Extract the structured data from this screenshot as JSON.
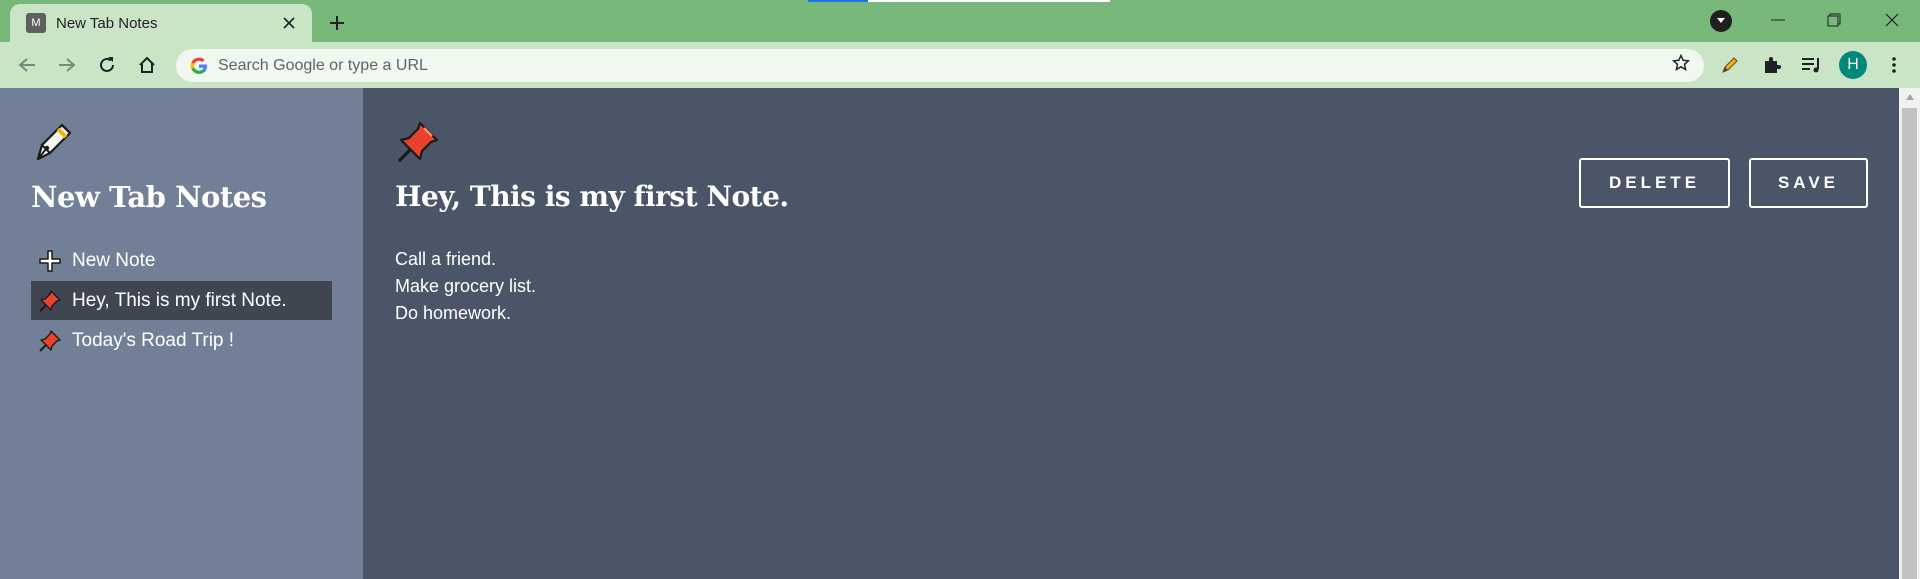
{
  "browser": {
    "tab": {
      "favicon_letter": "M",
      "title": "New Tab Notes"
    },
    "omnibox": {
      "placeholder": "Search Google or type a URL"
    },
    "profile_initial": "H",
    "icons": [
      "back-icon",
      "forward-icon",
      "reload-icon",
      "home-icon",
      "bookmark-star-icon",
      "pencil-extension-icon",
      "extensions-puzzle-icon",
      "reading-list-icon",
      "menu-kebab-icon",
      "tab-search-icon",
      "minimize-icon",
      "restore-icon",
      "close-icon"
    ]
  },
  "sidebar": {
    "title": "New Tab Notes",
    "items": [
      {
        "label": "New Note",
        "icon": "plus-icon",
        "active": false
      },
      {
        "label": "Hey, This is my first Note.",
        "icon": "pushpin-icon",
        "active": true
      },
      {
        "label": "Today's Road Trip !",
        "icon": "pushpin-icon",
        "active": false
      }
    ]
  },
  "note": {
    "title": "Hey, This is my first Note.",
    "lines": [
      "Call a friend.",
      "Make grocery list.",
      "Do homework."
    ]
  },
  "actions": {
    "delete_label": "DELETE",
    "save_label": "SAVE"
  },
  "colors": {
    "tabstrip": "#78b87a",
    "toolbar": "#c9e5c6",
    "sidebar": "#718096",
    "main": "#4a5568",
    "active_item": "#3f4652",
    "pin_red": "#e8412c",
    "avatar": "#00897b"
  }
}
